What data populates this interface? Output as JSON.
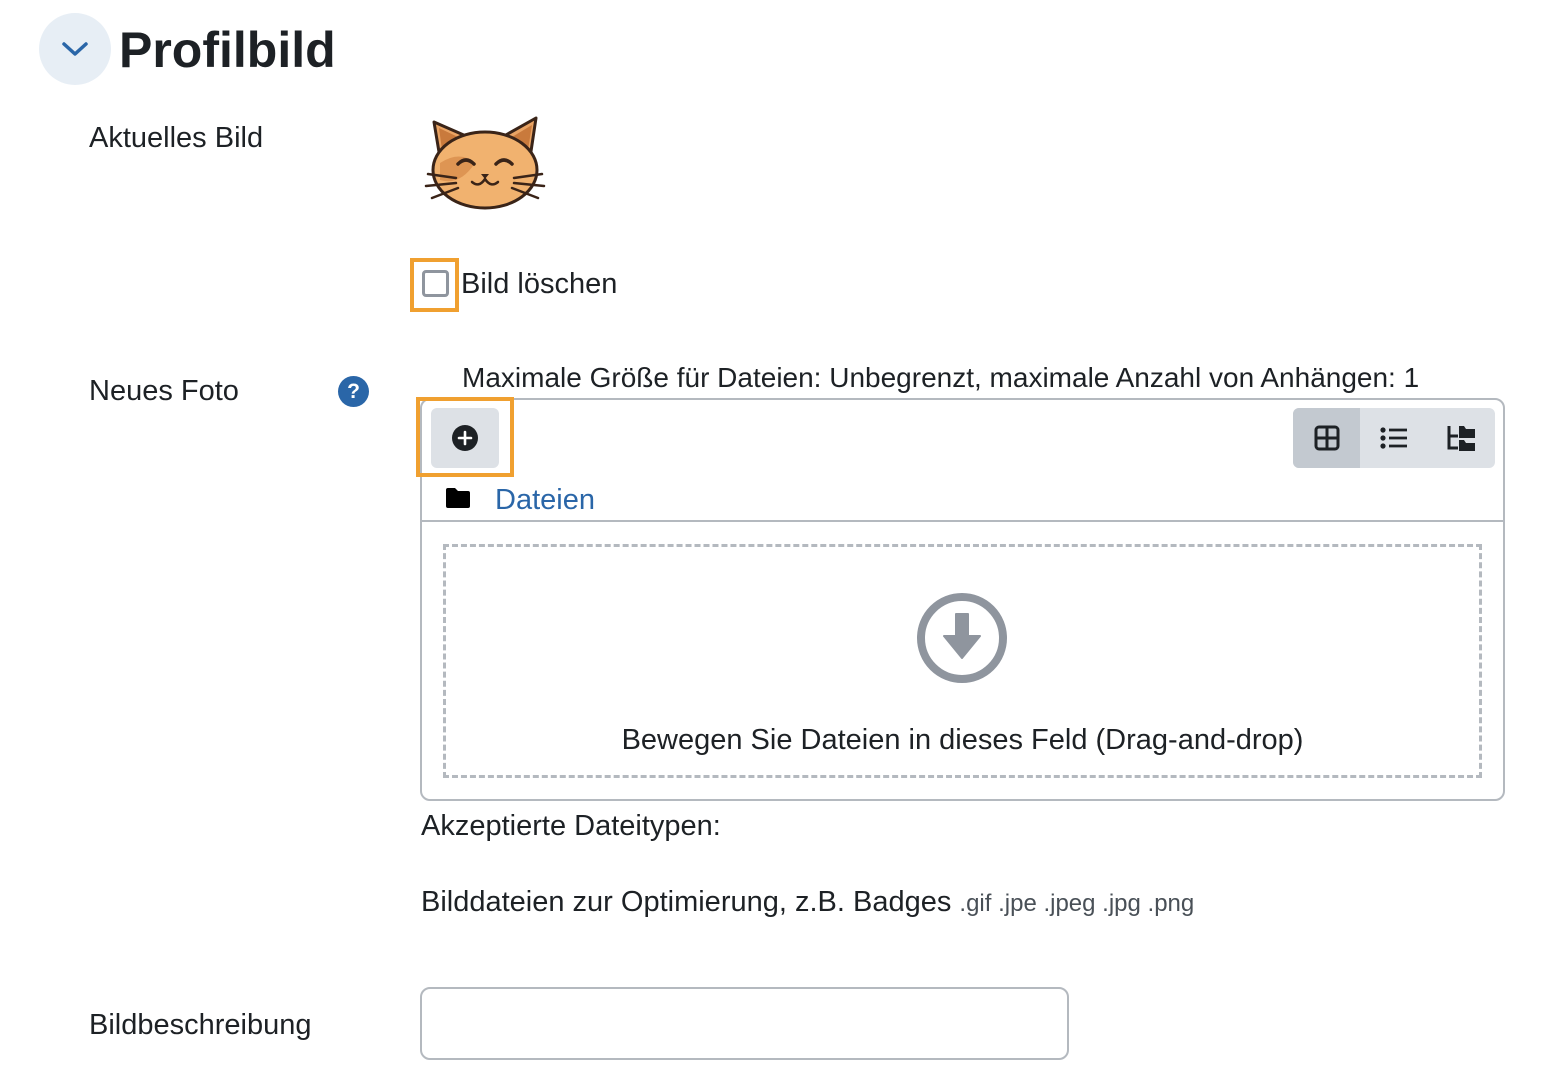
{
  "section": {
    "title": "Profilbild",
    "collapse_icon": "chevron-down-icon"
  },
  "current_picture": {
    "label": "Aktuelles Bild",
    "image": "cat-avatar"
  },
  "delete_picture": {
    "label": "Bild löschen",
    "checked": false
  },
  "new_photo": {
    "label": "Neues Foto",
    "help_icon": "question-icon",
    "help_symbol": "?",
    "max_info": "Maximale Größe für Dateien: Unbegrenzt, maximale Anzahl von Anhängen: 1",
    "toolbar": {
      "add_icon": "plus-circle-icon",
      "views": [
        {
          "icon": "grid-view-icon",
          "active": true
        },
        {
          "icon": "list-view-icon",
          "active": false
        },
        {
          "icon": "tree-view-icon",
          "active": false
        }
      ]
    },
    "path": {
      "folder_icon": "folder-icon",
      "label": "Dateien"
    },
    "dropzone": {
      "icon": "download-arrow-circle-icon",
      "text": "Bewegen Sie Dateien in dieses Feld (Drag-and-drop)"
    },
    "accepted_label": "Akzeptierte Dateitypen:",
    "filetypes_desc": "Bilddateien zur Optimierung, z.B. Badges",
    "filetypes_ext": ".gif .jpe .jpeg .jpg .png"
  },
  "image_description": {
    "label": "Bildbeschreibung",
    "value": "",
    "placeholder": ""
  },
  "colors": {
    "accent": "#2a66a8",
    "highlight": "#f0a030",
    "border": "#b4b9bf"
  }
}
